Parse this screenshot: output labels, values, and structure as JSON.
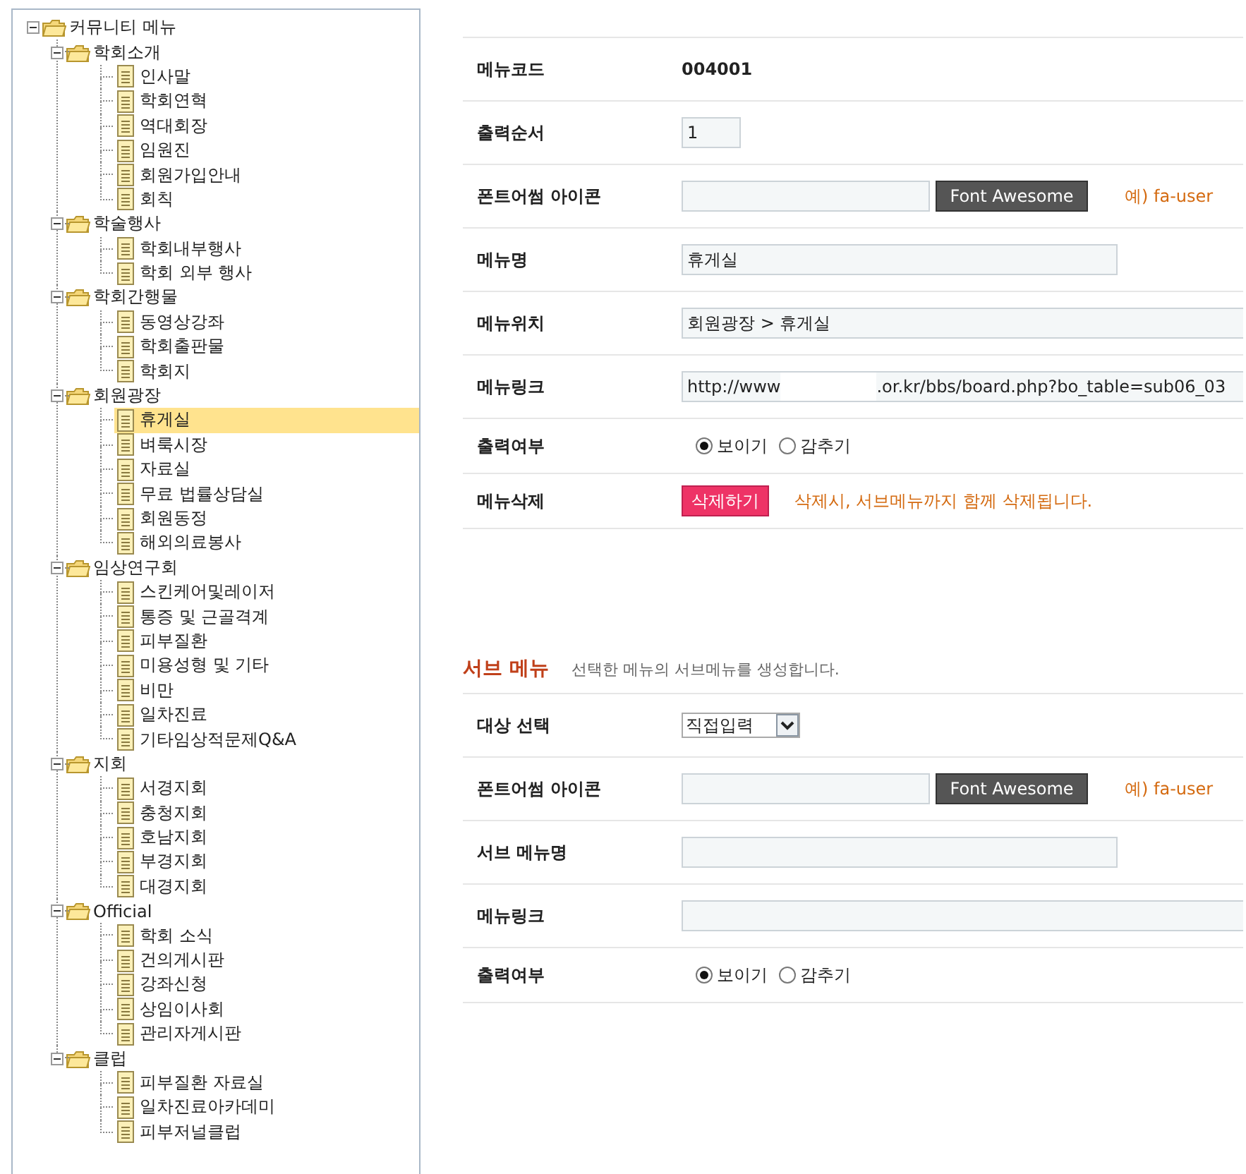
{
  "tree": {
    "label": "커뮤니티 메뉴",
    "expanded": true,
    "selected": false,
    "children": [
      {
        "label": "학회소개",
        "expanded": true,
        "selected": false,
        "children": [
          {
            "label": "인사말",
            "selected": false
          },
          {
            "label": "학회연혁",
            "selected": false
          },
          {
            "label": "역대회장",
            "selected": false
          },
          {
            "label": "임원진",
            "selected": false
          },
          {
            "label": "회원가입안내",
            "selected": false
          },
          {
            "label": "회칙",
            "selected": false
          }
        ]
      },
      {
        "label": "학술행사",
        "expanded": true,
        "selected": false,
        "children": [
          {
            "label": "학회내부행사",
            "selected": false
          },
          {
            "label": "학회 외부 행사",
            "selected": false
          }
        ]
      },
      {
        "label": "학회간행물",
        "expanded": true,
        "selected": false,
        "children": [
          {
            "label": "동영상강좌",
            "selected": false
          },
          {
            "label": "학회출판물",
            "selected": false
          },
          {
            "label": "학회지",
            "selected": false
          }
        ]
      },
      {
        "label": "회원광장",
        "expanded": true,
        "selected": false,
        "children": [
          {
            "label": "휴게실",
            "selected": true
          },
          {
            "label": "벼룩시장",
            "selected": false
          },
          {
            "label": "자료실",
            "selected": false
          },
          {
            "label": "무료 법률상담실",
            "selected": false
          },
          {
            "label": "회원동정",
            "selected": false
          },
          {
            "label": "해외의료봉사",
            "selected": false
          }
        ]
      },
      {
        "label": "임상연구회",
        "expanded": true,
        "selected": false,
        "children": [
          {
            "label": "스킨케어및레이저",
            "selected": false
          },
          {
            "label": "통증 및 근골격계",
            "selected": false
          },
          {
            "label": "피부질환",
            "selected": false
          },
          {
            "label": "미용성형 및 기타",
            "selected": false
          },
          {
            "label": "비만",
            "selected": false
          },
          {
            "label": "일차진료",
            "selected": false
          },
          {
            "label": "기타임상적문제Q&A",
            "selected": false
          }
        ]
      },
      {
        "label": "지회",
        "expanded": true,
        "selected": false,
        "children": [
          {
            "label": "서경지회",
            "selected": false
          },
          {
            "label": "충청지회",
            "selected": false
          },
          {
            "label": "호남지회",
            "selected": false
          },
          {
            "label": "부경지회",
            "selected": false
          },
          {
            "label": "대경지회",
            "selected": false
          }
        ]
      },
      {
        "label": "Official",
        "expanded": true,
        "selected": false,
        "children": [
          {
            "label": "학회 소식",
            "selected": false
          },
          {
            "label": "건의게시판",
            "selected": false
          },
          {
            "label": "강좌신청",
            "selected": false
          },
          {
            "label": "상임이사회",
            "selected": false
          },
          {
            "label": "관리자게시판",
            "selected": false
          }
        ]
      },
      {
        "label": "클럽",
        "expanded": true,
        "selected": false,
        "children": [
          {
            "label": "피부질환 자료실",
            "selected": false
          },
          {
            "label": "일차진료아카데미",
            "selected": false
          },
          {
            "label": "피부저널클럽",
            "selected": false
          }
        ]
      }
    ]
  },
  "menu_form": {
    "rows": [
      {
        "kind": "static",
        "label": "메뉴코드",
        "value": "004001"
      },
      {
        "kind": "short",
        "label": "출력순서",
        "value": "1"
      },
      {
        "kind": "icon",
        "label": "폰트어썸 아이콘",
        "button": "Font Awesome",
        "hint": "예) fa-user"
      },
      {
        "kind": "medium",
        "label": "메뉴명",
        "value": "휴게실"
      },
      {
        "kind": "wide",
        "label": "메뉴위치",
        "value": "회원광장 > 휴게실"
      },
      {
        "kind": "link",
        "label": "메뉴링크",
        "value_before_blank": "http://www",
        "value_after_blank": ".or.kr/bbs/board.php?bo_table=sub06_03"
      },
      {
        "kind": "radio",
        "label": "출력여부",
        "options": [
          {
            "label": "보이기",
            "selected": true
          },
          {
            "label": "감추기",
            "selected": false
          }
        ]
      },
      {
        "kind": "delete",
        "label": "메뉴삭제",
        "button": "삭제하기",
        "hint": "삭제시, 서브메뉴까지 함께 삭제됩니다."
      }
    ]
  },
  "sub_menu": {
    "title": "서브 메뉴",
    "description": "선택한 메뉴의 서브메뉴를 생성합니다.",
    "rows": [
      {
        "kind": "select",
        "label": "대상 선택",
        "value": "직접입력"
      },
      {
        "kind": "icon",
        "label": "폰트어썸 아이콘",
        "button": "Font Awesome",
        "hint": "예) fa-user"
      },
      {
        "kind": "medium",
        "label": "서브 메뉴명"
      },
      {
        "kind": "wide",
        "label": "메뉴링크"
      },
      {
        "kind": "radio",
        "label": "출력여부",
        "options": [
          {
            "label": "보이기",
            "selected": true
          },
          {
            "label": "감추기",
            "selected": false
          }
        ]
      }
    ]
  }
}
